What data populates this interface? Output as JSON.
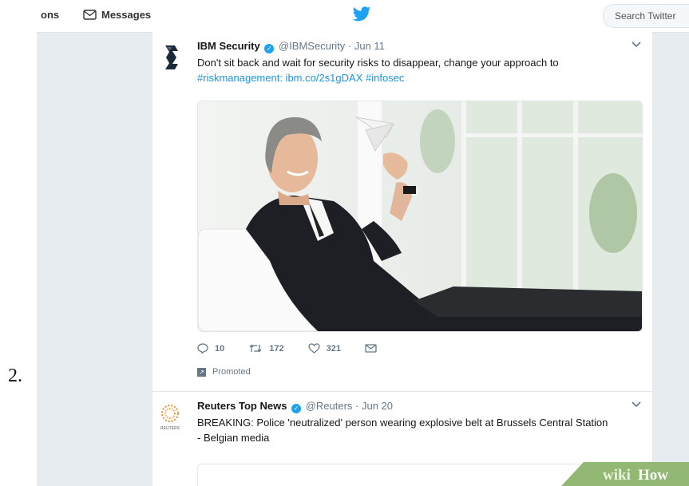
{
  "step_number": "2.",
  "navbar": {
    "notifications_partial": "ons",
    "messages_label": "Messages",
    "search_placeholder": "Search Twitter"
  },
  "tweets": [
    {
      "name": "IBM Security",
      "handle": "@IBMSecurity",
      "date": "· Jun 11",
      "text": "Don't sit back and wait for security risks to disappear, change your approach to",
      "links": "#riskmanagement: ibm.co/2s1gDAX #infosec",
      "media_icon": "businessman-paper-plane-photo",
      "replies": "10",
      "retweets": "172",
      "likes": "321",
      "promoted_label": "Promoted"
    },
    {
      "name": "Reuters Top News",
      "handle": "@Reuters",
      "date": "· Jun 20",
      "text": "BREAKING: Police 'neutralized' person wearing explosive belt at Brussels Central Station - Belgian media",
      "avatar_caption": "REUTERS"
    }
  ],
  "watermark": {
    "part1": "wiki",
    "part2": "How"
  },
  "colors": {
    "twitter_blue": "#1da1f2",
    "link_blue": "#1b95e0",
    "background": "#e6ecf0"
  }
}
